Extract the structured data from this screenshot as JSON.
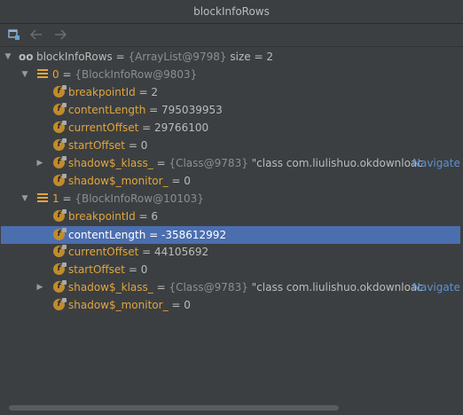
{
  "window": {
    "title": "blockInfoRows"
  },
  "toolbar": {
    "buttons": [
      "restore-layout-icon",
      "back-arrow-icon",
      "forward-arrow-icon"
    ]
  },
  "tree": {
    "root": {
      "name": "blockInfoRows",
      "eq": " = ",
      "ref": "{ArrayList@9798}",
      "extra": "  size = 2"
    },
    "items": [
      {
        "name": "0",
        "eq": " = ",
        "ref": "{BlockInfoRow@9803}",
        "fields": [
          {
            "name": "breakpointId",
            "eq": " = ",
            "value": "2"
          },
          {
            "name": "contentLength",
            "eq": " = ",
            "value": "795039953"
          },
          {
            "name": "currentOffset",
            "eq": " = ",
            "value": "29766100"
          },
          {
            "name": "startOffset",
            "eq": " = ",
            "value": "0"
          },
          {
            "name": "shadow$_klass_",
            "eq": " = ",
            "ref": "{Class@9783}",
            "value": " \"class com.liulishuo.okdownloac",
            "nav": "Navigate"
          },
          {
            "name": "shadow$_monitor_",
            "eq": " = ",
            "value": "0"
          }
        ]
      },
      {
        "name": "1",
        "eq": " = ",
        "ref": "{BlockInfoRow@10103}",
        "fields": [
          {
            "name": "breakpointId",
            "eq": " = ",
            "value": "6"
          },
          {
            "name": "contentLength",
            "eq": " = ",
            "value": "-358612992"
          },
          {
            "name": "currentOffset",
            "eq": " = ",
            "value": "44105692"
          },
          {
            "name": "startOffset",
            "eq": " = ",
            "value": "0"
          },
          {
            "name": "shadow$_klass_",
            "eq": " = ",
            "ref": "{Class@9783}",
            "value": " \"class com.liulishuo.okdownloac",
            "nav": "Navigate"
          },
          {
            "name": "shadow$_monitor_",
            "eq": " = ",
            "value": "0"
          }
        ]
      }
    ]
  },
  "colors": {
    "background": "#3c3f41",
    "selection": "#4b6eaf",
    "field_name": "#e0a53d",
    "navigate_link": "#5a93d6"
  }
}
